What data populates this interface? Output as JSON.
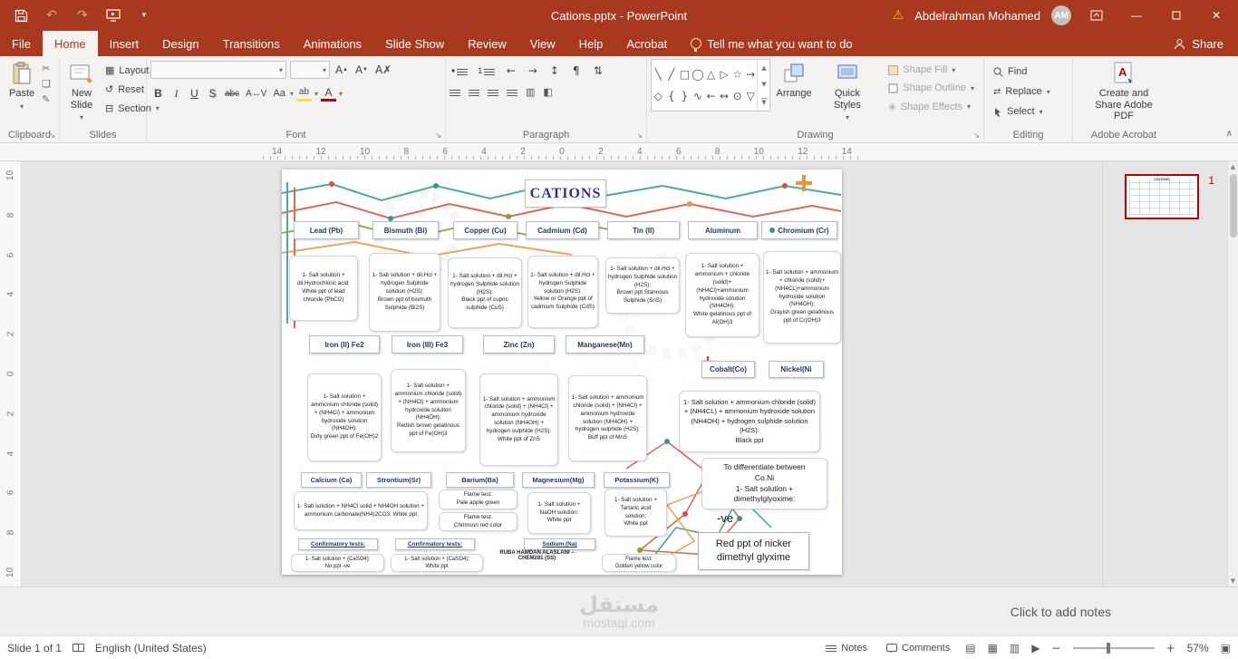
{
  "colors": {
    "titlebar_red": "#A8391E",
    "selection_red": "#C00000",
    "header_blue": "#203864",
    "title_blue": "#2E3192",
    "decor_teal": "#2E9B8F",
    "decor_orange": "#E8963C"
  },
  "title_bar": {
    "title": "Cations.pptx  -  PowerPoint",
    "user_name": "Abdelrahman Mohamed",
    "user_initials": "AM"
  },
  "tabs": {
    "file": "File",
    "items": [
      "Home",
      "Insert",
      "Design",
      "Transitions",
      "Animations",
      "Slide Show",
      "Review",
      "View",
      "Help",
      "Acrobat"
    ],
    "tell_me": "Tell me what you want to do",
    "share": "Share"
  },
  "ribbon": {
    "paste": "Paste",
    "clipboard_label": "Clipboard",
    "new_slide": "New Slide",
    "layout": "Layout",
    "reset": "Reset",
    "section": "Section",
    "slides_label": "Slides",
    "font_label": "Font",
    "paragraph_label": "Paragraph",
    "arrange": "Arrange",
    "quick_styles": "Quick Styles",
    "shape_fill": "Shape Fill",
    "shape_outline": "Shape Outline",
    "shape_effects": "Shape Effects",
    "drawing_label": "Drawing",
    "find": "Find",
    "replace": "Replace",
    "select": "Select",
    "editing_label": "Editing",
    "acrobat_button": "Create and Share Adobe PDF",
    "acrobat_label": "Adobe Acrobat"
  },
  "rulers": {
    "horizontal": [
      "14",
      "12",
      "10",
      "8",
      "6",
      "4",
      "2",
      "0",
      "2",
      "4",
      "6",
      "8",
      "10",
      "12",
      "14"
    ],
    "vertical": [
      "10",
      "8",
      "6",
      "4",
      "2",
      "0",
      "2",
      "4",
      "6",
      "8",
      "10"
    ]
  },
  "slide": {
    "title": "CATIONS",
    "row1": [
      {
        "header": "Lead (Pb)",
        "body": "1- Salt solution + dil.Hydrochloric acid:\nWhite ppt of lead chloride (PbCl2)"
      },
      {
        "header": "Bismuth (Bi)",
        "body": "1- Salt solution + dil.Hcl + hydrogen Sulphide solution (H2S):\nBrown ppt of bismuth Sulphide (Bi2S)"
      },
      {
        "header": "Copper (Cu)",
        "body": "1- Salt solution + dil.Hcl + hydrogen Sulphide solution (H2S):\nBlack ppt of cupric sulphide (CuS)"
      },
      {
        "header": "Cadmium (Cd)",
        "body": "1- Salt solution + dil.Hcl + hydrogen Sulphide solution (H2S):\nYellow or Orange ppt of cadmium Sulphide (CdS)"
      },
      {
        "header": "Tin (II)",
        "body": "1- Salt solution + dil.Hcl + hydrogen Sulphide solution (H2S):\nBrown ppt Stannous Sulphide (SnS)"
      },
      {
        "header": "Aluminum",
        "body": "1- Salt solution + ammonium + chloride (solid)+(NH4Cl)+ammonium hydroxide solution (NH4OH):\nWhite gelatinous ppt of Al(OH)3"
      },
      {
        "header": "Chromium (Cr)",
        "body": "1- Salt solution + ammonium + chloride (solid)+(NH4CL)+ammonium hydroxide solution (NH4OH):\nGrayish green gelatinous ppt of Cr(OH)3"
      }
    ],
    "row2": [
      {
        "header": "Iron (II) Fe2",
        "body": "1- Salt solution + ammonium chloride (solid) + (NH4Cl) + ammonium hydroxide solution (NH4OH):\nDirty green ppt of Fe(OH)2"
      },
      {
        "header": "Iron (III) Fe3",
        "body": "1- Salt solution + ammonium chloride (solid) + (NH4Cl) + ammonium hydroxide solution (NH4OH):\nRedish brown gelatinous ppt of Fe(OH)3"
      },
      {
        "header": "Zinc (Zn)",
        "body": "1- Salt solution + ammonium chloride (solid) + (NH4Cl) + ammonium hydroxide solution (NH4OH) + hydrogen sulphide (H2S):\nWhite ppt of ZnS"
      },
      {
        "header": "Manganese(Mn)",
        "body": "1- Salt solution + ammonium chloride (solid) + (NH4Cl) + ammonium hydroxide solution (NH4OH) + hydrogen sulphide (H2S):\nBuff ppt of MnS"
      }
    ],
    "cobalt_header": "Cobalt(Co)",
    "nickel_header": "Nickel(Ni",
    "cobalt_nickel_body": "1- Salt solution + ammonium chloride (solid) + (NH4CL) + ammonium hydroxide solution (NH4OH) + hydrogen sulphide solution (H2S):\nBlack ppt",
    "row3": {
      "calcium_header": "Calcium (Ca)",
      "calcium_body": "1- Salt solution + NH4Cl solid + NH4OH solution + ammonium carbonate(NH4)2CO3: White ppt",
      "strontium_header": "Strontium(Sr)",
      "barium_header": "Barium(Ba)",
      "magnesium_header": "Magnesium(Mg)",
      "magnesium_body": "1- Salt solution +\nNaOH solution:\nWhite ppt",
      "potassium_header": "Potassium(K)",
      "potassium_body": "1- Salt solution +\nTartaric acid\nsolution:\nWhite ppt",
      "flame_barium": "Flame test:\nPale apple green",
      "flame_strontium": "Flame test:\nChrimson red color"
    },
    "bottom": {
      "confirmatory1_header": "Confirmatory tests:",
      "confirmatory1_body": "1- Salt solution + (CaSO4):\nNo ppt -ve",
      "confirmatory2_header": "Confirmatory tests:",
      "confirmatory2_body": "1- Salt solution + (CaSO4):\nWhite ppt",
      "credit": "RUBA HAMDAN ALASLANI –\nCHEM281 (SS)",
      "sodium_header": "Sodium (Na)",
      "sodium_body": "Flame test:\nGolden yellow color"
    },
    "right": {
      "differentiate": "To differentiate between\nCo.Ni\n1- Salt solution +\ndimethylglyoxime:",
      "negative": "-ve",
      "red_ppt": "Red ppt of nicker\ndimethyl glyxime"
    }
  },
  "thumbnails": {
    "slide_number": "1"
  },
  "notes": {
    "placeholder": "Click to add notes",
    "watermark_ar": "مستقل",
    "watermark_en": "mostaql.com"
  },
  "status_bar": {
    "slide_counter": "Slide 1 of 1",
    "language": "English (United States)",
    "notes": "Notes",
    "comments": "Comments",
    "zoom": "57%"
  }
}
